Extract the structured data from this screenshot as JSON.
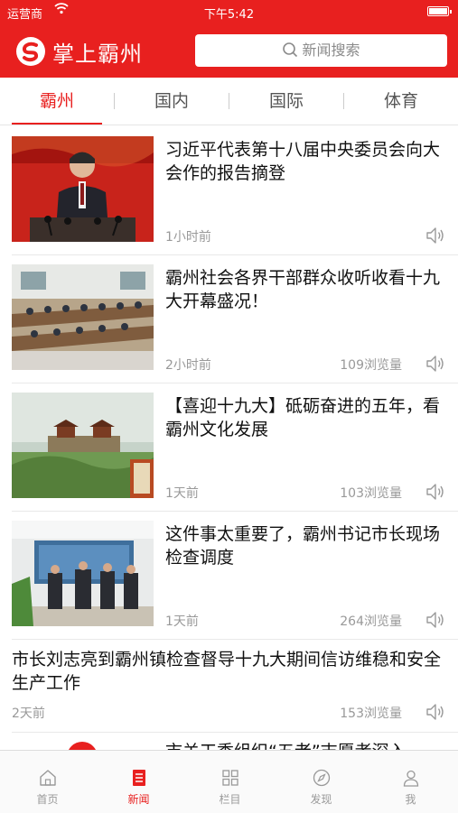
{
  "status_bar": {
    "carrier": "运营商",
    "time": "下午5:42"
  },
  "header": {
    "app_title": "掌上霸州",
    "search_placeholder": "新闻搜索"
  },
  "tabs": [
    "霸州",
    "国内",
    "国际",
    "体育"
  ],
  "news": [
    {
      "title": "习近平代表第十八届中央委员会向大会作的报告摘登",
      "time": "1小时前",
      "views": ""
    },
    {
      "title": "霸州社会各界干部群众收听收看十九大开幕盛况！",
      "time": "2小时前",
      "views": "109浏览量"
    },
    {
      "title": "【喜迎十九大】砥砺奋进的五年，看霸州文化发展",
      "time": "1天前",
      "views": "103浏览量"
    },
    {
      "title": "这件事太重要了，霸州书记市长现场检查调度",
      "time": "1天前",
      "views": "264浏览量"
    },
    {
      "title": "市长刘志亮到霸州镇检查督导十九大期间信访维稳和安全生产工作",
      "time": "2天前",
      "views": "153浏览量"
    }
  ],
  "partial_item_title": "市关工委组织“五老”志愿者深入",
  "bottom_nav": [
    "首页",
    "新闻",
    "栏目",
    "发现",
    "我"
  ],
  "colors": {
    "brand": "#e8201f"
  }
}
